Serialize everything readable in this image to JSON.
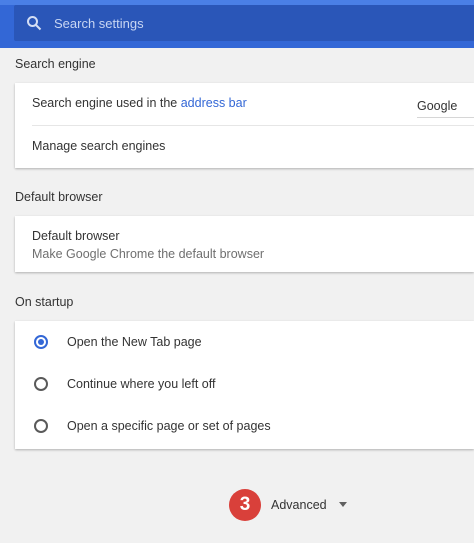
{
  "search": {
    "placeholder": "Search settings",
    "icon": "search-icon"
  },
  "colors": {
    "accent": "#3367d6",
    "badge": "#d9403a"
  },
  "search_engine": {
    "section_title": "Search engine",
    "used_in_prefix": "Search engine used in the ",
    "used_in_link": "address bar",
    "selected_engine": "Google",
    "manage_label": "Manage search engines"
  },
  "default_browser": {
    "section_title": "Default browser",
    "title": "Default browser",
    "subtitle": "Make Google Chrome the default browser"
  },
  "on_startup": {
    "section_title": "On startup",
    "options": [
      {
        "label": "Open the New Tab page",
        "checked": true
      },
      {
        "label": "Continue where you left off",
        "checked": false
      },
      {
        "label": "Open a specific page or set of pages",
        "checked": false
      }
    ]
  },
  "advanced": {
    "badge": "3",
    "label": "Advanced"
  }
}
